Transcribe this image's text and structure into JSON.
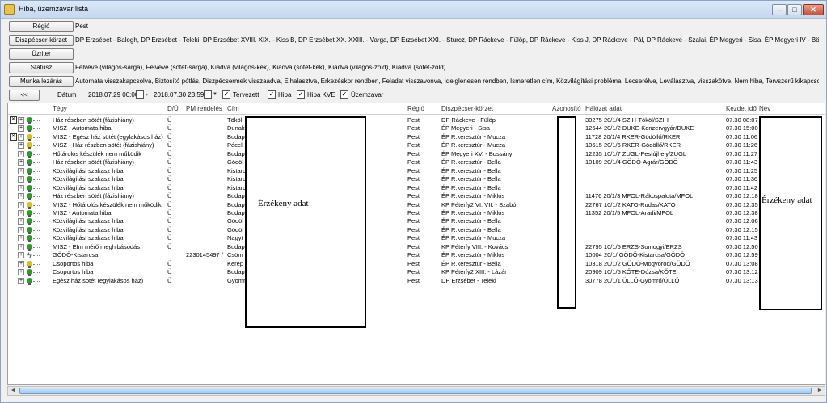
{
  "window": {
    "title": "Hiba, üzemzavar lista"
  },
  "filters": {
    "regio": {
      "label": "Régió",
      "value": "Pest"
    },
    "diszpecser": {
      "label": "Diszpécser-körzet",
      "value": "DP Erzsébet - Balogh, DP Erzsébet - Teleki, DP Erzsébet XVIII. XIX. - Kiss B, DP Erzsébet XX. XXIII. - Varga, DP Erzsébet XXI. - Sturcz, DP Ráckeve - Fülöp, DP Ráckeve - Kiss J, DP Ráckeve - Pál, DP Ráckeve - Szalai, ÉP Megyeri - Sisa, ÉP Megyeri IV - Böczi, ÉP Megyeri V. -"
    },
    "uzritel": {
      "label": "Üzriter",
      "value": ""
    },
    "statusz": {
      "label": "Státusz",
      "value": "Felvéve (világos-sárga), Felvéve (sötét-sárga), Kiadva (világos-kék), Kiadva (sötét-kék), Kiadva (világos-zöld), Kiadva (sötét-zöld)"
    },
    "munka": {
      "label": "Munka lezárás",
      "value": "Automata visszakapcsolva, Biztosító pótlás, Diszpécsermek visszaadva, Elhalasztva, Érkezéskor rendben, Feladat visszavonva, Ideiglenesen rendben, Ismeretlen cím, Közvilágítási probléma, Lecserélve, Leválasztva, visszakötve, Nem hiba, Tervszerű kikapcsolás,"
    }
  },
  "controls": {
    "back_label": "<<",
    "datum_label": "Dátum",
    "date_from": "2018.07.29 00:00",
    "date_sep": "-",
    "date_to": "2018.07.30 23:59",
    "checks": [
      {
        "label": "Tervezett",
        "checked": true
      },
      {
        "label": "Hiba",
        "checked": true
      },
      {
        "label": "Hiba KVE",
        "checked": true
      },
      {
        "label": "Üzemzavar",
        "checked": true
      }
    ]
  },
  "columns": {
    "tipus": "Tégy",
    "du": "D/Ü",
    "pm": "PM rendelés",
    "cim": "Cím",
    "regio": "Régió",
    "diszpecser": "Diszpécser-körzet",
    "azonosito": "Azonosító",
    "halozat": "Hálózat adat",
    "kezdet": "Kezdet idő",
    "nev": "Név"
  },
  "rows": [
    {
      "tipus": "Ház részben sötét (fázishiány)",
      "du": "Ü",
      "pm": "",
      "cim": "Tököl",
      "regio": "Pest",
      "disz": "DP Ráckeve - Fülöp",
      "halozat": "30275 20/1/4 SZIH-Tököl/SZIH",
      "kezdet": "07.30 08:07",
      "bulb": "#2e9a2e",
      "blocked": true
    },
    {
      "tipus": "MISZ - Automata hiba",
      "du": "Ü",
      "pm": "",
      "cim": "Dunak",
      "regio": "Pest",
      "disz": "ÉP Megyeri - Sisa",
      "halozat": "12644 20/1/2 DUKE-Konzervgyár/DUKE",
      "kezdet": "07.30 15:00",
      "bulb": "#2e9a2e",
      "blocked": false
    },
    {
      "tipus": "MISZ - Egész ház sötét (egylakásos ház)",
      "du": "Ü",
      "pm": "",
      "cim": "Budap",
      "regio": "Pest",
      "disz": "ÉP R.keresztúr - Mucza",
      "halozat": "11728 20/1/4 RKER-Gödöllő/RKER",
      "kezdet": "07.30 11:06",
      "bulb": "#d8c020",
      "blocked": true
    },
    {
      "tipus": "MISZ - Ház részben sötét (fázishiány)",
      "du": "Ü",
      "pm": "",
      "cim": "Pécel",
      "regio": "Pest",
      "disz": "ÉP R.keresztúr - Mucza",
      "halozat": "10615 20/1/6 RKER-Gödöllő/RKER",
      "kezdet": "07.30 11:26",
      "bulb": "#d8c020",
      "blocked": false
    },
    {
      "tipus": "Hőtárolós készülék nem működik",
      "du": "Ü",
      "pm": "",
      "cim": "Budap",
      "regio": "Pest",
      "disz": "ÉP Megyeri XV. - Bossányi",
      "halozat": "12235 10/1/7 ZUGL-Pestújhely/ZUGL",
      "kezdet": "07.30 11:27",
      "bulb": "#2e9a2e",
      "blocked": false
    },
    {
      "tipus": "Ház részben sötét (fázishiány)",
      "du": "Ü",
      "pm": "",
      "cim": "Gödöl",
      "regio": "Pest",
      "disz": "ÉP R.keresztúr - Bella",
      "halozat": "10109 20/1/4 GÖDÖ-Agrár/GÖDÖ",
      "kezdet": "07.30 11:43",
      "bulb": "#2e9a2e",
      "blocked": false
    },
    {
      "tipus": "Közvilágítási szakasz hiba",
      "du": "Ü",
      "pm": "",
      "cim": "Kistarc",
      "regio": "Pest",
      "disz": "ÉP R.keresztúr - Bella",
      "halozat": "",
      "kezdet": "07.30 11:25",
      "bulb": "#2e9a2e",
      "blocked": false
    },
    {
      "tipus": "Közvilágítási szakasz hiba",
      "du": "Ü",
      "pm": "",
      "cim": "Kistarc",
      "regio": "Pest",
      "disz": "ÉP R.keresztúr - Bella",
      "halozat": "",
      "kezdet": "07.30 11:36",
      "bulb": "#2e9a2e",
      "blocked": false
    },
    {
      "tipus": "Közvilágítási szakasz hiba",
      "du": "Ü",
      "pm": "",
      "cim": "Kistarc",
      "regio": "Pest",
      "disz": "ÉP R.keresztúr - Bella",
      "halozat": "",
      "kezdet": "07.30 11:42",
      "bulb": "#2e9a2e",
      "blocked": false
    },
    {
      "tipus": "Ház részben sötét (fázishiány)",
      "du": "Ü",
      "pm": "",
      "cim": "Budap",
      "regio": "Pest",
      "disz": "ÉP R.keresztúr - Miklós",
      "halozat": "11476 20/1/3 MFOL-Rákospalota/MFOL",
      "kezdet": "07.30 12:18",
      "bulb": "#2e9a2e",
      "blocked": false
    },
    {
      "tipus": "MISZ - Hőtárolós készülék nem működik",
      "du": "Ü",
      "pm": "",
      "cim": "Budap",
      "regio": "Pest",
      "disz": "KP Péterfy2 VI. VII. - Szabó",
      "halozat": "22767 10/1/2 KATO-Rudas/KATO",
      "kezdet": "07.30 12:35",
      "bulb": "#d8c020",
      "blocked": false
    },
    {
      "tipus": "MISZ - Automata hiba",
      "du": "Ü",
      "pm": "",
      "cim": "Budap",
      "regio": "Pest",
      "disz": "ÉP R.keresztúr - Miklós",
      "halozat": "11352 20/1/5 MFOL-Aradi/MFOL",
      "kezdet": "07.30 12:38",
      "bulb": "#2e9a2e",
      "blocked": false
    },
    {
      "tipus": "Közvilágítási szakasz hiba",
      "du": "Ü",
      "pm": "",
      "cim": "Gödöl",
      "regio": "Pest",
      "disz": "ÉP R.keresztúr - Bella",
      "halozat": "",
      "kezdet": "07.30 12:06",
      "bulb": "#2e9a2e",
      "blocked": false
    },
    {
      "tipus": "Közvilágítási szakasz hiba",
      "du": "Ü",
      "pm": "",
      "cim": "Gödöl",
      "regio": "Pest",
      "disz": "ÉP R.keresztúr - Bella",
      "halozat": "",
      "kezdet": "07.30 12:15",
      "bulb": "#2e9a2e",
      "blocked": false
    },
    {
      "tipus": "Közvilágítási szakasz hiba",
      "du": "Ü",
      "pm": "",
      "cim": "Nagyt",
      "regio": "Pest",
      "disz": "ÉP R.keresztúr - Mucza",
      "halozat": "",
      "kezdet": "07.30 11:43",
      "bulb": "#2e9a2e",
      "blocked": false
    },
    {
      "tipus": "MISZ - Efm mérő meghibásodás",
      "du": "Ü",
      "pm": "",
      "cim": "Budap",
      "regio": "Pest",
      "disz": "KP Péterfy VIII. - Kovács",
      "halozat": "22795 10/1/5 ERZS-Somogyi/ERZS",
      "kezdet": "07.30 12:50",
      "bulb": "#2e9a2e",
      "blocked": false
    },
    {
      "tipus": "GÖDÖ-Kistarcsa",
      "du": "",
      "pm": "2230145497 /",
      "cim": "Csöm",
      "regio": "Pest",
      "disz": "ÉP R.keresztúr - Miklós",
      "halozat": "10004 20/1/ GÖDÖ-Kistarcsa/GÖDÖ",
      "kezdet": "07.30 12:59",
      "bulb": "",
      "blocked": false,
      "bolt": true
    },
    {
      "tipus": "Csoportos hiba",
      "du": "Ü",
      "pm": "",
      "cim": "Kerep",
      "regio": "Pest",
      "disz": "ÉP R.keresztúr - Bella",
      "halozat": "10318 20/1/2 GÖDÖ-Mogyoród/GÖDÖ",
      "kezdet": "07.30 13:08",
      "bulb": "#d8c020",
      "blocked": false
    },
    {
      "tipus": "Csoportos hiba",
      "du": "Ü",
      "pm": "",
      "cim": "Budap",
      "regio": "Pest",
      "disz": "KP Péterfy2 XIII. - Lázár",
      "halozat": "20909 10/1/5 KŐTE-Dózsa/KŐTE",
      "kezdet": "07.30 13:12",
      "bulb": "#2e9a2e",
      "blocked": false
    },
    {
      "tipus": "Egész ház sötét (egylakásos ház)",
      "du": "Ü",
      "pm": "",
      "cim": "Gyömr",
      "regio": "Pest",
      "disz": "DP Erzsébet - Teleki",
      "halozat": "30778 20/1/1 ÜLLŐ-Gyömrő/ÜLLŐ",
      "kezdet": "07.30 13:13",
      "bulb": "#2e9a2e",
      "blocked": false
    }
  ],
  "redaction": {
    "label": "Érzékeny adat"
  },
  "colors": {
    "accent": "#6a9ccc",
    "green_bulb": "#2e9a2e",
    "yellow_bulb": "#d8c020"
  }
}
